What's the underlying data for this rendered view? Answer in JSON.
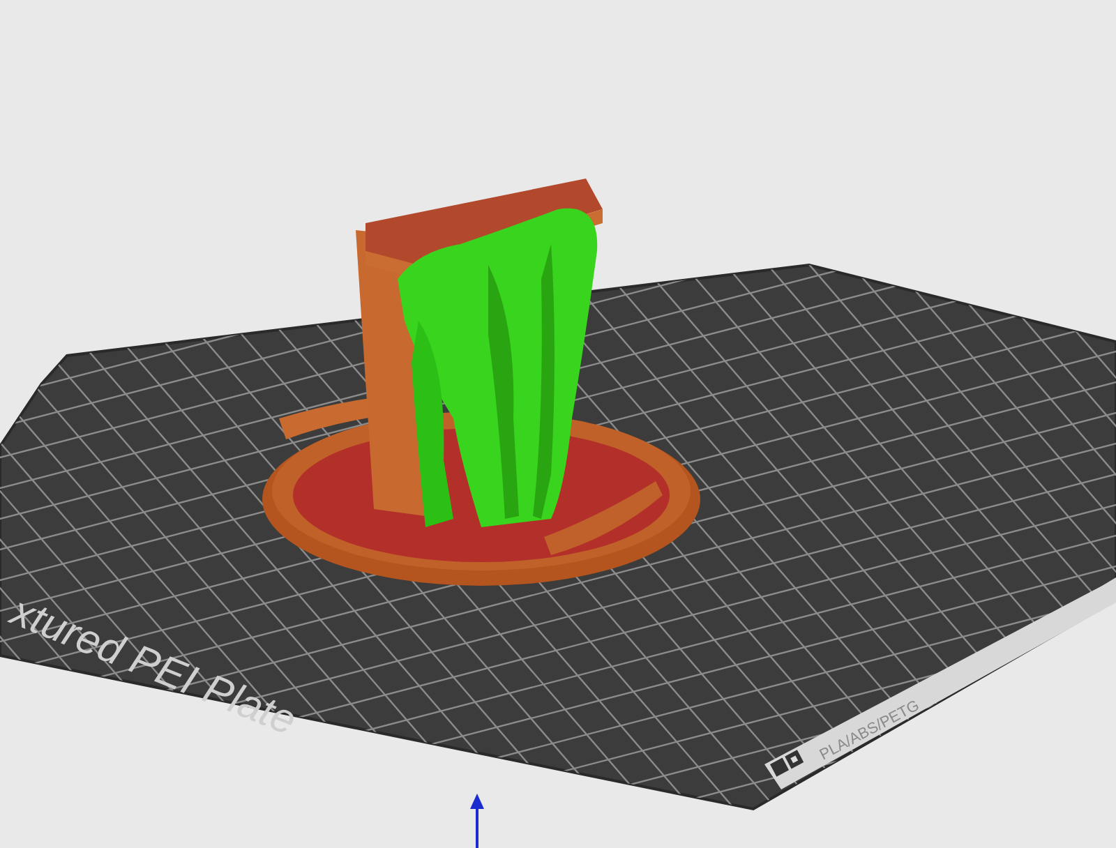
{
  "viewport": {
    "plate_label": "xtured PEI Plate",
    "plate_strip_label": "PLA/ABS/PETG"
  }
}
